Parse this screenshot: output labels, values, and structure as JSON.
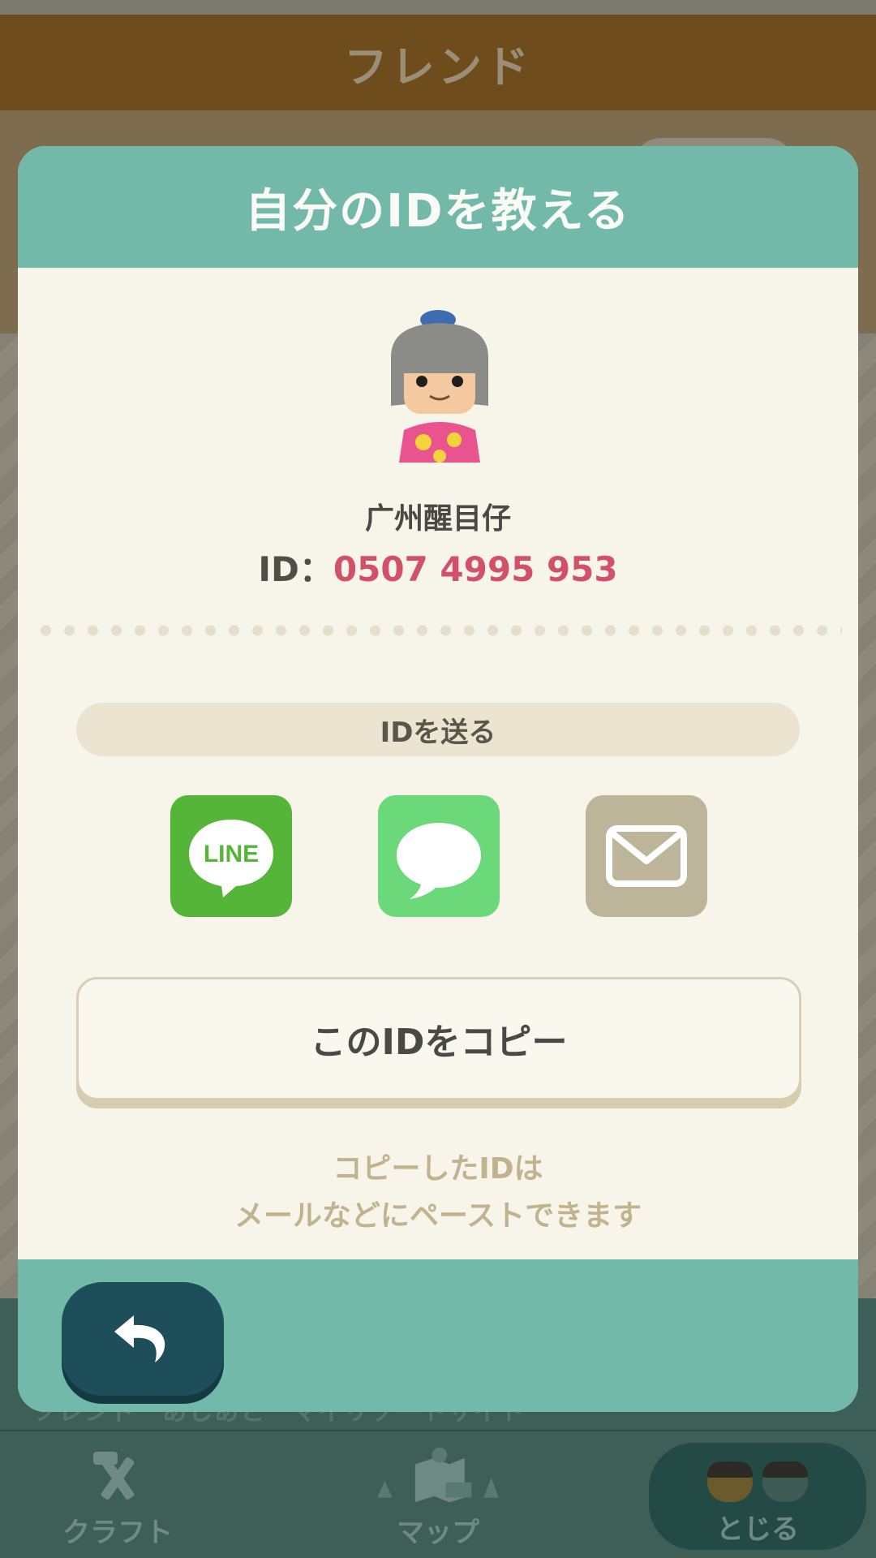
{
  "background": {
    "title": "フレンド",
    "bottom_row_text": "フレンド　あしあと　マイリゾートサイト",
    "nav": {
      "craft_label": "クラフト",
      "map_label": "マップ",
      "close_label": "とじる"
    }
  },
  "modal": {
    "title": "自分のIDを教える",
    "user_name": "广州醒目仔",
    "id_prefix": "ID：",
    "id_value": "0507 4995 953",
    "send_label": "IDを送る",
    "share": {
      "line_text": "LINE",
      "icons": [
        "line-icon",
        "message-icon",
        "mail-icon"
      ]
    },
    "copy_button": "このIDをコピー",
    "hint_line1": "コピーしたIDは",
    "hint_line2": "メールなどにペーストできます"
  },
  "colors": {
    "header_teal": "#73b9aa",
    "id_pink": "#d2506a",
    "line_green": "#55b538",
    "message_green": "#6bd97a",
    "mail_beige": "#bdb59a",
    "back_button": "#1f4e5b"
  }
}
